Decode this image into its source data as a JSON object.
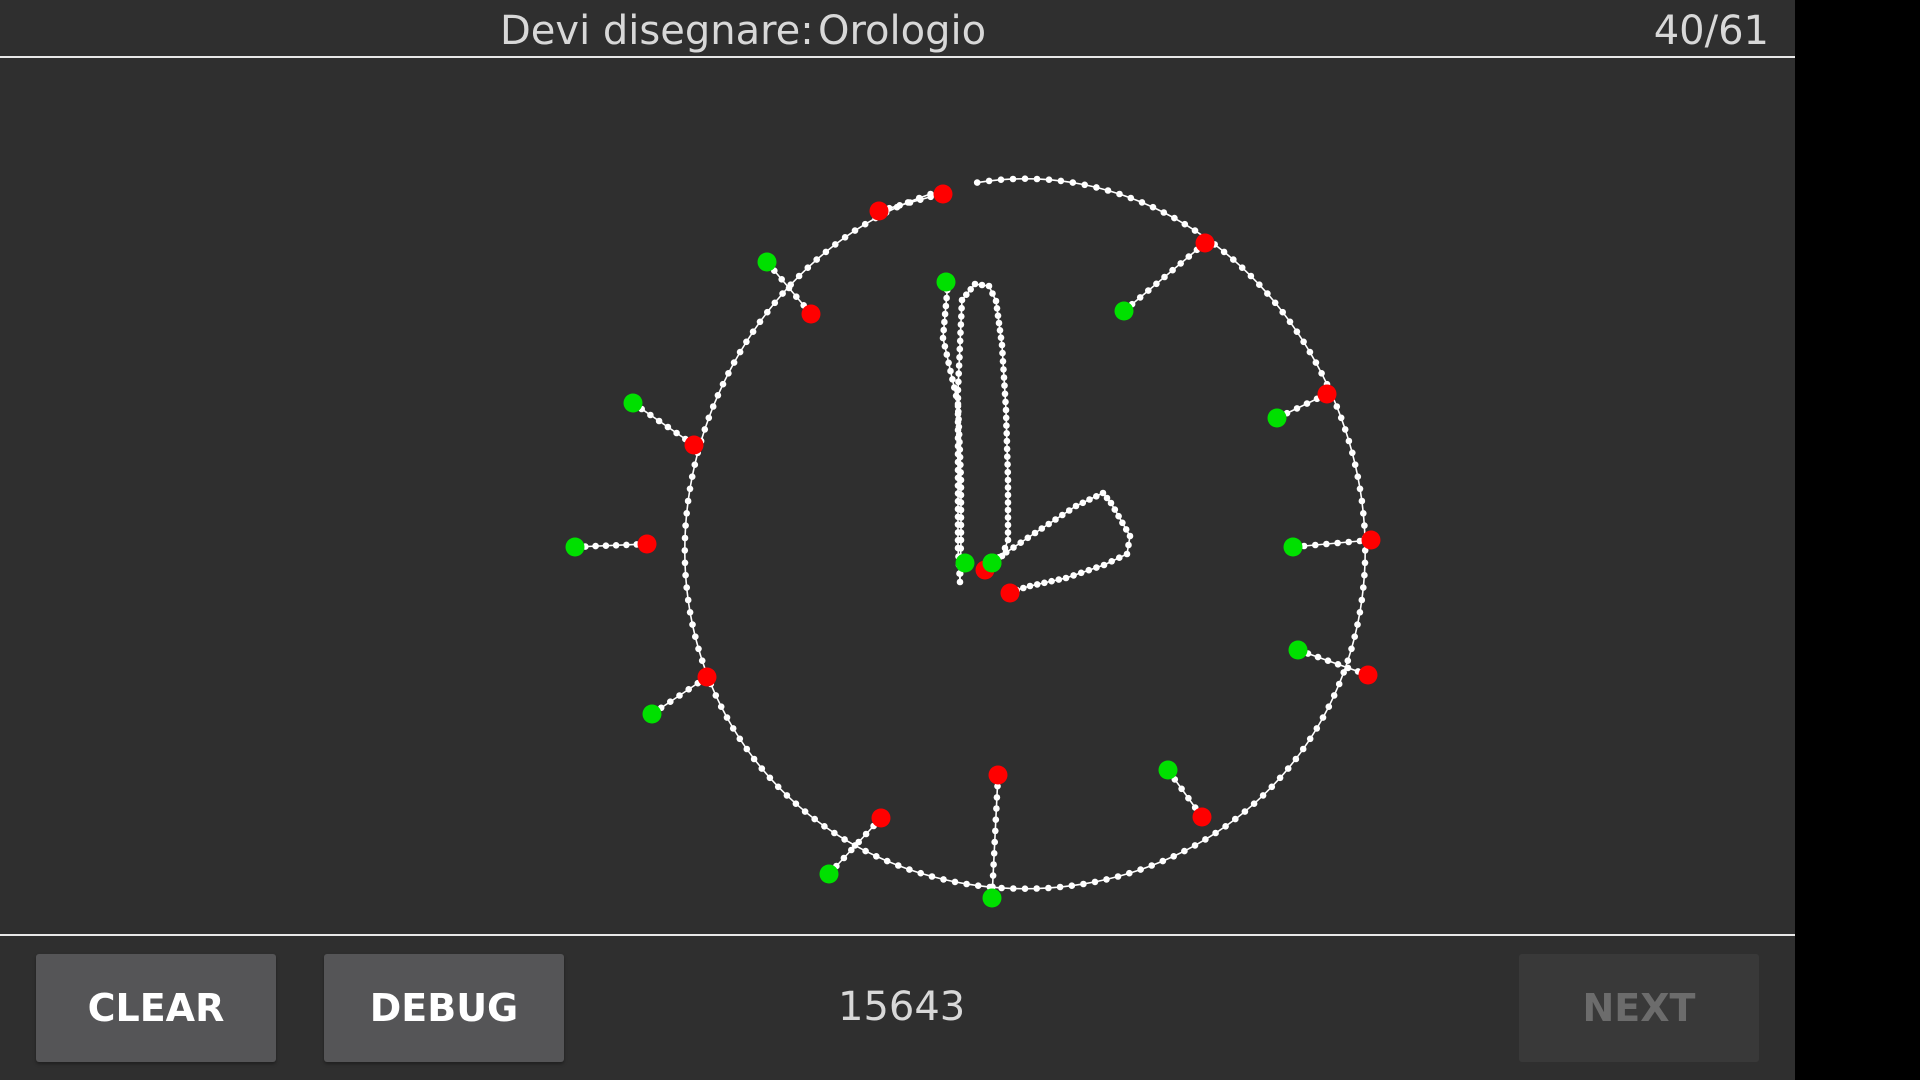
{
  "header": {
    "prompt_label": "Devi disegnare:",
    "prompt_word": "Orologio",
    "counter": "40/61"
  },
  "toolbar": {
    "clear_label": "CLEAR",
    "debug_label": "DEBUG",
    "score": "15643",
    "next_label": "NEXT"
  },
  "colors": {
    "background": "#2f2f2f",
    "stroke": "#ffffff",
    "start_point": "#00e000",
    "end_point": "#ff0000",
    "button": "#555557",
    "button_disabled": "#393939"
  },
  "drawing": {
    "subject": "clock",
    "stroke_count": 15,
    "tick_marks": 12,
    "hands": 2
  }
}
